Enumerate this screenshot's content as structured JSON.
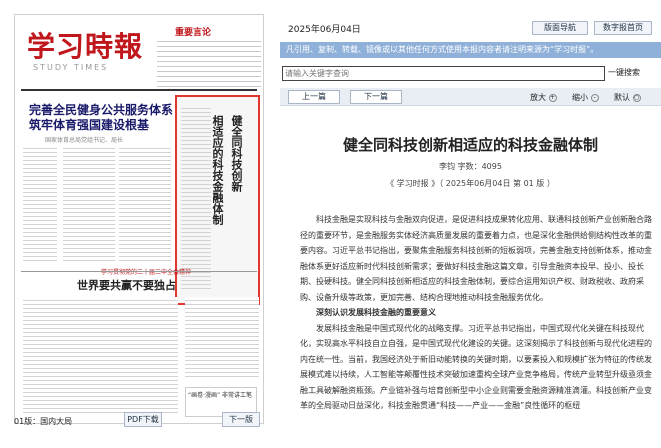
{
  "left": {
    "masthead": "学习時報",
    "masthead_sub": "STUDY TIMES",
    "important_label": "重要言论",
    "headline_line1": "完善全民健身公共服务体系",
    "headline_line2": "筑牢体育强国建设根基",
    "headline_byline": "国家体育总局党组书记、局长",
    "vertical_title_1": "健全同科技创新",
    "vertical_title_2": "相适应的科技金融体制",
    "bottom_headline": "世界要共赢不要独占",
    "red_strip": "学习贯彻党的二十届三中全会精神",
    "thumb_text": "“画卷·漫画”\n非常讲工笔",
    "page_label": "01版：国内大局",
    "pdf_button": "PDF下载",
    "next_button": "下一版"
  },
  "right": {
    "date": "2025年06月04日",
    "nav_button": "版面导航",
    "digital_button": "数字报首页",
    "banner": "凡引用、复制、转载、镜像或以其他任何方式使用本报内容者请注明来源为“学习时报”。",
    "search_placeholder": "请输入关键字查询",
    "search_button": "一键搜索",
    "prev_article": "上一篇",
    "next_article": "下一篇",
    "zoom_in": "放大",
    "zoom_in_sym": "+",
    "zoom_out": "缩小",
    "zoom_out_sym": "-",
    "zoom_default": "默认",
    "zoom_default_sym": "○",
    "article_title": "健全同科技创新相适应的科技金融体制",
    "author_line": "李钧  字数：4095",
    "source_line": "《 学习时报 》（ 2025年06月04日   第 01 版 ）",
    "para1": "科技金融是实现科技与金融双向促进，是促进科技成果转化应用、联通科技创新产业创新融合路径的重要环节，是金融服务实体经济高质量发展的重要着力点，也是深化金融供给侧结构性改革的重要内容。习近平总书记指出，要聚焦金融服务科技创新的短板弱项，完善金融支持创新体系，推动金融体系更好适应新时代科技创新需求；要做好科技金融这篇文章，引导金融资本投早、投小、投长期、投硬科技。健全同科技创新相适应的科技金融体制，要综合运用知识产权、财政税收、政府采购、设备升级等政策，更加完善、结构合理地推动科技金融服务优化。",
    "section_head": "深刻认识发展科技金融的重要意义",
    "para2": "发展科技金融是中国式现代化的战略支撑。习近平总书记指出，中国式现代化关键在科技现代化，实现高水平科技自立自强，是中国式现代化建设的关键。这深刻揭示了科技创新与现代化进程的内在统一性。当前，我国经济处于新旧动能转换的关键时期，以要素投入和规模扩张为特征的传统发展模式难以持续，人工智能等颠覆性技术突破加速重构全球产业竞争格局，传统产业转型升级亟须金融工具破解融资瓶颈。产业链补强与培育创新型中小企业则需要金融资源精准滴灌。科技创新产业变革的全局驱动日益深化，科技金融贯通“科技——产业——金融”良性循环的枢纽"
  }
}
